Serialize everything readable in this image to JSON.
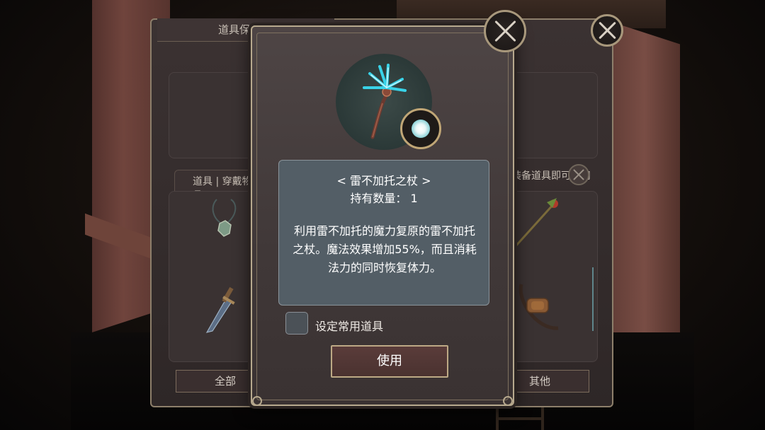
{
  "back_panel": {
    "title": "道具保管箱",
    "tab_label": "道具 | 穿戴物品",
    "equip_hint": "装备道具即可使用",
    "filter_all": "全部",
    "filter_other": "其他"
  },
  "dialog": {
    "item_name": "< 雷不加托之杖 >",
    "count_label": "持有数量：",
    "count_value": "1",
    "description": "利用雷不加托的魔力复原的雷不加托之杖。魔法效果增加55%，而且消耗法力的同时恢复体力。",
    "checkbox_label": "设定常用道具",
    "checkbox_checked": false,
    "use_button": "使用"
  },
  "icons": {
    "close": "close-x-icon",
    "rank": "glowing-orb-rank-icon",
    "item": "lightning-staff-icon"
  },
  "colors": {
    "frame_gold": "#b7a98e",
    "desc_bg": "#535e66",
    "staff_glow": "#39d3e8"
  }
}
